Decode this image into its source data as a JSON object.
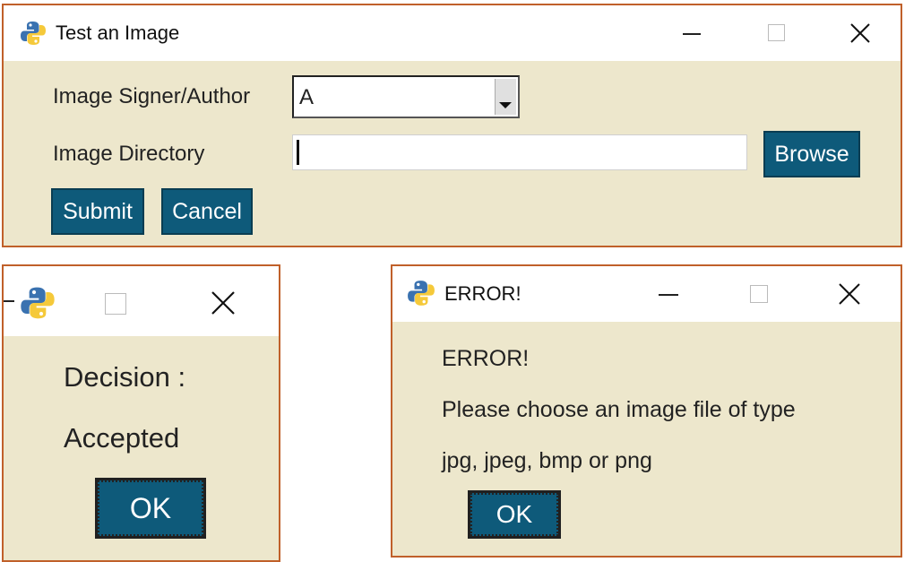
{
  "main_window": {
    "title": "Test an Image",
    "signer_label": "Image Signer/Author",
    "signer_value": "A",
    "directory_label": "Image Directory",
    "directory_value": "",
    "browse_label": "Browse",
    "submit_label": "Submit",
    "cancel_label": "Cancel"
  },
  "decision_window": {
    "decision_label": "Decision :",
    "decision_value": "Accepted",
    "ok_label": "OK"
  },
  "error_window": {
    "title": "ERROR!",
    "heading": "ERROR!",
    "message_line1": "Please choose an image file of type",
    "message_line2": "jpg, jpeg, bmp or png",
    "ok_label": "OK"
  },
  "colors": {
    "window_bg": "#ede7cc",
    "window_border": "#c0602a",
    "button_bg": "#0e5a7a",
    "python_blue": "#3a72b0",
    "python_yellow": "#f5c93a"
  },
  "icons": [
    "python-icon",
    "minimize-icon",
    "maximize-icon",
    "close-icon",
    "dropdown-arrow-icon"
  ]
}
